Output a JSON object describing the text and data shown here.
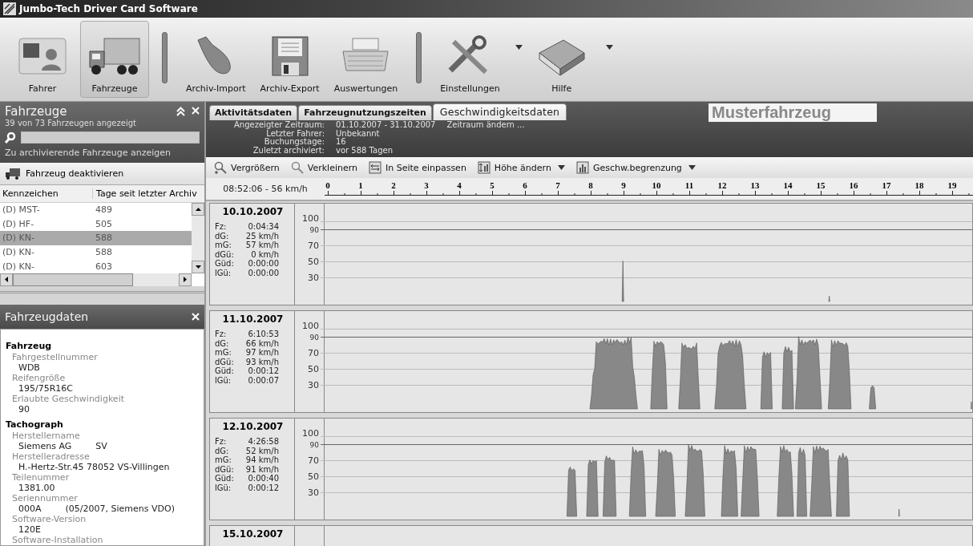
{
  "window": {
    "title": "Jumbo-Tech Driver Card Software"
  },
  "toolbar": [
    {
      "label": "Fahrer",
      "kind": "card",
      "selected": false,
      "dropdown": false
    },
    {
      "label": "Fahrzeuge",
      "kind": "truck",
      "selected": true,
      "dropdown": false
    },
    {
      "kind": "separator"
    },
    {
      "label": "Archiv-Import",
      "kind": "stick",
      "selected": false,
      "dropdown": false
    },
    {
      "label": "Archiv-Export",
      "kind": "floppy",
      "selected": false,
      "dropdown": false
    },
    {
      "label": "Auswertungen",
      "kind": "printer",
      "selected": false,
      "dropdown": false
    },
    {
      "kind": "separator"
    },
    {
      "label": "Einstellungen",
      "kind": "tools",
      "selected": false,
      "dropdown": true
    },
    {
      "label": "Hilfe",
      "kind": "book",
      "selected": false,
      "dropdown": true
    }
  ],
  "vehicles_panel": {
    "title": "Fahrzeuge",
    "count": "39 von 73 Fahrzeugen angezeigt",
    "link": "Zu archivierende Fahrzeuge anzeigen",
    "action": "Fahrzeug deaktivieren",
    "columns": [
      "Kennzeichen",
      "Tage seit letzter Archiv"
    ],
    "rows": [
      {
        "cells": [
          "(D) MST-",
          "489"
        ],
        "selected": false
      },
      {
        "cells": [
          "(D) HF-",
          "505"
        ],
        "selected": false
      },
      {
        "cells": [
          "(D) KN-",
          "588"
        ],
        "selected": true
      },
      {
        "cells": [
          "(D) KN-",
          "588"
        ],
        "selected": false
      },
      {
        "cells": [
          "(D) KN-",
          "603"
        ],
        "selected": false
      }
    ]
  },
  "details_panel": {
    "title": "Fahrzeugdaten",
    "sections": [
      {
        "heading": "Fahrzeug",
        "fields": [
          {
            "label": "Fahrgestellnummer",
            "values": [
              "WDB"
            ]
          },
          {
            "label": "Reifengröße",
            "values": [
              "195/75R16C"
            ]
          },
          {
            "label": "Erlaubte Geschwindigkeit",
            "values": [
              "90"
            ]
          }
        ]
      },
      {
        "heading": "Tachograph",
        "fields": [
          {
            "label": "Herstellername",
            "values": [
              "Siemens AG",
              "SV"
            ]
          },
          {
            "label": "Herstelleradresse",
            "values": [
              "H.-Hertz-Str.45 78052 VS-Villingen"
            ]
          },
          {
            "label": "Teilenummer",
            "values": [
              "1381.00"
            ]
          },
          {
            "label": "Seriennummer",
            "values": [
              "000A",
              "(05/2007, Siemens VDO)"
            ]
          },
          {
            "label": "Software-Version",
            "values": [
              "120E"
            ]
          },
          {
            "label": "Software-Installation"
          }
        ]
      }
    ]
  },
  "tabs": [
    {
      "label": "Aktivitätsdaten",
      "selected": false
    },
    {
      "label": "Fahrzeugnutzungszeiten",
      "selected": false
    },
    {
      "label": "Geschwindigkeitsdaten",
      "selected": true
    }
  ],
  "vehicle_name": "Musterfahrzeug",
  "info": [
    {
      "label": "Angezeigter Zeitraum:",
      "value": "01.10.2007 - 31.10.2007",
      "link": "Zeitraum ändern ..."
    },
    {
      "label": "Letzter Fahrer:",
      "value": "Unbekannt"
    },
    {
      "label": "Buchungstage:",
      "value": "16"
    },
    {
      "label": "Zuletzt archiviert:",
      "value": "vor 588 Tagen"
    }
  ],
  "chart_toolbar": [
    {
      "label": "Vergrößern",
      "kind": "zoom-in",
      "dropdown": false
    },
    {
      "label": "Verkleinern",
      "kind": "zoom-out",
      "dropdown": false
    },
    {
      "label": "In Seite einpassen",
      "kind": "fit",
      "dropdown": false
    },
    {
      "label": "Höhe ändern",
      "kind": "height",
      "dropdown": true
    },
    {
      "label": "Geschw.begrenzung",
      "kind": "limit",
      "dropdown": true
    }
  ],
  "ruler": {
    "readout": "08:52:06 - 56 km/h",
    "hours": [
      "0",
      "1",
      "2",
      "3",
      "4",
      "5",
      "6",
      "7",
      "8",
      "9",
      "10",
      "11",
      "12",
      "13",
      "14",
      "15",
      "16",
      "17",
      "18",
      "19"
    ]
  },
  "days": [
    {
      "date": "10.10.2007",
      "stats": [
        {
          "label": "Fz:",
          "value": "0:04:34"
        },
        {
          "label": "dG:",
          "value": "25 km/h"
        },
        {
          "label": "mG:",
          "value": "57 km/h"
        },
        {
          "label": "dGü:",
          "value": "0 km/h"
        },
        {
          "label": "Güd:",
          "value": "0:00:00"
        },
        {
          "label": "lGü:",
          "value": "0:00:00"
        }
      ],
      "y_labels": [
        "100",
        "90",
        "70",
        "50",
        "30"
      ]
    },
    {
      "date": "11.10.2007",
      "stats": [
        {
          "label": "Fz:",
          "value": "6:10:53"
        },
        {
          "label": "dG:",
          "value": "66 km/h"
        },
        {
          "label": "mG:",
          "value": "97 km/h"
        },
        {
          "label": "dGü:",
          "value": "93 km/h"
        },
        {
          "label": "Güd:",
          "value": "0:00:12"
        },
        {
          "label": "lGü:",
          "value": "0:00:07"
        }
      ],
      "y_labels": [
        "100",
        "90",
        "70",
        "50",
        "30"
      ]
    },
    {
      "date": "12.10.2007",
      "stats": [
        {
          "label": "Fz:",
          "value": "4:26:58"
        },
        {
          "label": "dG:",
          "value": "52 km/h"
        },
        {
          "label": "mG:",
          "value": "94 km/h"
        },
        {
          "label": "dGü:",
          "value": "91 km/h"
        },
        {
          "label": "Güd:",
          "value": "0:00:40"
        },
        {
          "label": "lGü:",
          "value": "0:00:12"
        }
      ],
      "y_labels": [
        "100",
        "90",
        "70",
        "50",
        "30"
      ]
    },
    {
      "date": "15.10.2007"
    }
  ]
}
